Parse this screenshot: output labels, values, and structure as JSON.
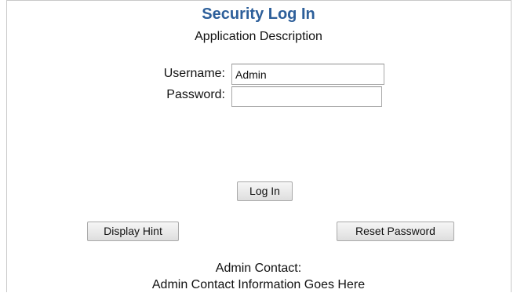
{
  "header": {
    "title": "Security Log In",
    "subtitle": "Application Description"
  },
  "form": {
    "username_label": "Username:",
    "username_value": "Admin",
    "password_label": "Password:",
    "password_value": ""
  },
  "buttons": {
    "login": "Log In",
    "display_hint": "Display Hint",
    "reset_password": "Reset Password"
  },
  "footer": {
    "contact_heading": "Admin Contact:",
    "contact_info": "Admin Contact Information Goes Here"
  },
  "colors": {
    "title": "#2d5f9a",
    "text": "#111111",
    "background": "#ffffff"
  }
}
